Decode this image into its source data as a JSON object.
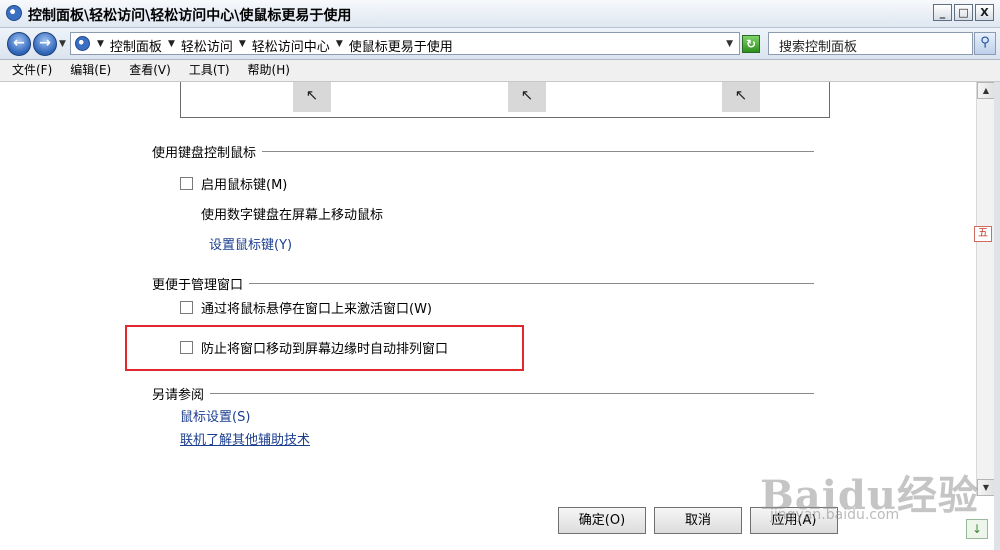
{
  "window": {
    "title": "控制面板\\轻松访问\\轻松访问中心\\使鼠标更易于使用",
    "controls": {
      "minimize": "_",
      "maximize": "□",
      "close": "X"
    }
  },
  "address_bar": {
    "breadcrumbs": [
      "控制面板",
      "轻松访问",
      "轻松访问中心",
      "使鼠标更易于使用"
    ],
    "search_placeholder": "搜索控制面板"
  },
  "menu": [
    "文件(F)",
    "编辑(E)",
    "查看(V)",
    "工具(T)",
    "帮助(H)"
  ],
  "sections": {
    "keyboard_mouse": {
      "heading": "使用键盘控制鼠标",
      "enable_mouse_keys": {
        "label": "启用鼠标键(M)",
        "checked": false
      },
      "description": "使用数字键盘在屏幕上移动鼠标",
      "setup_link": "设置鼠标键(Y)"
    },
    "window_management": {
      "heading": "更便于管理窗口",
      "hover_activate": {
        "label": "通过将鼠标悬停在窗口上来激活窗口(W)",
        "checked": false
      },
      "prevent_arrange": {
        "label": "防止将窗口移动到屏幕边缘时自动排列窗口",
        "checked": false
      }
    },
    "see_also": {
      "heading": "另请参阅",
      "links": [
        "鼠标设置(S)",
        "联机了解其他辅助技术"
      ]
    }
  },
  "buttons": {
    "ok": "确定(O)",
    "cancel": "取消",
    "apply": "应用(A)"
  },
  "watermark": {
    "logo": "Baidu经验",
    "url": "jingyan.baidu.com"
  },
  "colors": {
    "highlight_border": "#e0282e",
    "link": "#1b3e8f"
  }
}
